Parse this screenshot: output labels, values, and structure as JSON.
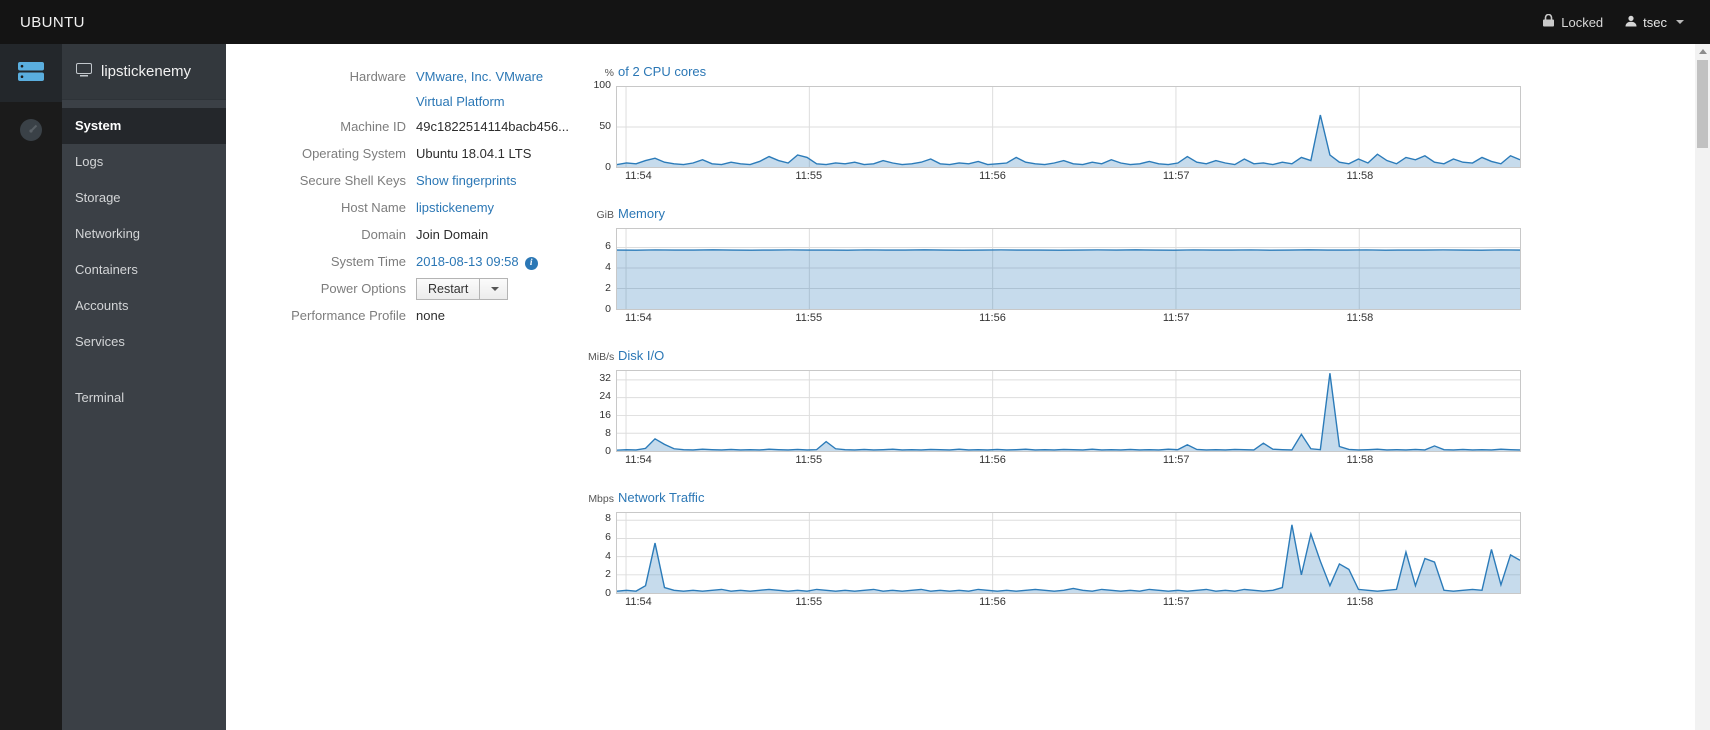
{
  "topbar": {
    "brand": "UBUNTU",
    "locked_label": "Locked",
    "user_label": "tsec"
  },
  "app_strip": {
    "items": [
      {
        "name": "host",
        "icon": "server-icon",
        "active": true
      },
      {
        "name": "dashboard",
        "icon": "gauge-icon",
        "active": false
      }
    ]
  },
  "sidebar": {
    "hostname": "lipstickenemy",
    "items": [
      {
        "label": "System",
        "active": true
      },
      {
        "label": "Logs",
        "active": false
      },
      {
        "label": "Storage",
        "active": false
      },
      {
        "label": "Networking",
        "active": false
      },
      {
        "label": "Containers",
        "active": false
      },
      {
        "label": "Accounts",
        "active": false
      },
      {
        "label": "Services",
        "active": false
      }
    ],
    "footer_items": [
      {
        "label": "Terminal",
        "active": false
      }
    ]
  },
  "system_info": {
    "rows": [
      {
        "label": "Hardware",
        "value": "VMware, Inc. VMware Virtual Platform",
        "style": "link"
      },
      {
        "label": "Machine ID",
        "value": "49c1822514114bacb456...",
        "style": "text"
      },
      {
        "label": "Operating System",
        "value": "Ubuntu 18.04.1 LTS",
        "style": "text"
      },
      {
        "label": "Secure Shell Keys",
        "value": "Show fingerprints",
        "style": "link"
      },
      {
        "label": "Host Name",
        "value": "lipstickenemy",
        "style": "link"
      },
      {
        "label": "Domain",
        "value": "Join Domain",
        "style": "action"
      },
      {
        "label": "System Time",
        "value": "2018-08-13 09:58",
        "style": "link",
        "info_icon": true
      },
      {
        "label": "Power Options",
        "value": "Restart",
        "style": "button_dropdown"
      },
      {
        "label": "Performance Profile",
        "value": "none",
        "style": "text"
      }
    ]
  },
  "colors": {
    "link": "#2b77b5",
    "chart_line": "#2b7bb9",
    "chart_fill": "#2b7bb9",
    "chart_fill_opacity": 0.27,
    "grid": "#dddddd",
    "topbar_bg": "#141414",
    "sidebar_bg": "#3b4046"
  },
  "chart_data": [
    {
      "type": "area",
      "title": "of 2 CPU cores",
      "unit": "%",
      "ylim": [
        0,
        100
      ],
      "yticks": [
        0,
        50,
        100
      ],
      "xticks": [
        "11:54",
        "11:55",
        "11:56",
        "11:57",
        "11:58"
      ],
      "xtick_fracs": [
        0.01,
        0.213,
        0.416,
        0.619,
        0.822
      ],
      "values": [
        3,
        5,
        4,
        8,
        11,
        6,
        4,
        3,
        5,
        9,
        4,
        3,
        6,
        4,
        3,
        7,
        13,
        8,
        5,
        15,
        12,
        4,
        3,
        5,
        4,
        6,
        3,
        4,
        8,
        5,
        3,
        4,
        6,
        10,
        4,
        3,
        5,
        4,
        7,
        3,
        4,
        5,
        12,
        6,
        4,
        3,
        5,
        8,
        4,
        3,
        6,
        4,
        9,
        5,
        3,
        4,
        7,
        4,
        3,
        5,
        13,
        6,
        4,
        8,
        5,
        3,
        10,
        4,
        5,
        3,
        6,
        4,
        12,
        8,
        65,
        15,
        6,
        4,
        10,
        5,
        16,
        8,
        4,
        12,
        9,
        14,
        6,
        4,
        10,
        6,
        5,
        12,
        7,
        4,
        14,
        9
      ]
    },
    {
      "type": "area",
      "title": "Memory",
      "unit": "GiB",
      "ylim": [
        0,
        7.8
      ],
      "yticks": [
        0,
        2,
        4,
        6
      ],
      "xticks": [
        "11:54",
        "11:55",
        "11:56",
        "11:57",
        "11:58"
      ],
      "xtick_fracs": [
        0.01,
        0.213,
        0.416,
        0.619,
        0.822
      ],
      "values": [
        5.75,
        5.74,
        5.76,
        5.75,
        5.75,
        5.77,
        5.75,
        5.74,
        5.75,
        5.76,
        5.75,
        5.75,
        5.74,
        5.76,
        5.75,
        5.75,
        5.77,
        5.75,
        5.74,
        5.75,
        5.76,
        5.75,
        5.75,
        5.74,
        5.75,
        5.76,
        5.75,
        5.77,
        5.75,
        5.74,
        5.76,
        5.75,
        5.75,
        5.76,
        5.74,
        5.75,
        5.77,
        5.75,
        5.75,
        5.76,
        5.74,
        5.75,
        5.75,
        5.76,
        5.75,
        5.74,
        5.76,
        5.75
      ]
    },
    {
      "type": "area",
      "title": "Disk I/O",
      "unit": "MiB/s",
      "ylim": [
        0,
        36
      ],
      "yticks": [
        0,
        8,
        16,
        24,
        32
      ],
      "xticks": [
        "11:54",
        "11:55",
        "11:56",
        "11:57",
        "11:58"
      ],
      "xtick_fracs": [
        0.01,
        0.213,
        0.416,
        0.619,
        0.822
      ],
      "values": [
        0.4,
        0.6,
        0.5,
        1.2,
        5.5,
        3.0,
        1.0,
        0.6,
        0.5,
        0.8,
        0.6,
        0.5,
        0.7,
        0.5,
        0.6,
        0.5,
        0.8,
        0.6,
        0.5,
        0.7,
        0.5,
        0.6,
        4.2,
        1.0,
        0.6,
        0.5,
        0.7,
        0.5,
        0.6,
        0.8,
        0.5,
        0.6,
        0.5,
        0.7,
        0.6,
        0.5,
        0.8,
        0.5,
        0.6,
        0.5,
        0.7,
        0.5,
        0.6,
        0.8,
        0.5,
        0.6,
        0.5,
        0.7,
        0.6,
        0.5,
        0.8,
        0.5,
        0.6,
        0.5,
        0.7,
        0.5,
        0.6,
        0.5,
        0.8,
        0.6,
        2.8,
        0.7,
        0.5,
        0.6,
        0.5,
        0.7,
        0.6,
        0.5,
        3.5,
        0.8,
        0.6,
        0.5,
        7.5,
        1.0,
        0.6,
        35.0,
        2.0,
        0.7,
        0.5,
        0.6,
        0.8,
        0.5,
        0.6,
        0.5,
        0.7,
        0.5,
        2.3,
        0.6,
        0.5,
        0.7,
        0.5,
        0.6,
        0.5,
        0.8,
        0.6,
        0.5
      ]
    },
    {
      "type": "area",
      "title": "Network Traffic",
      "unit": "Mbps",
      "ylim": [
        0,
        8.8
      ],
      "yticks": [
        0,
        2,
        4,
        6,
        8
      ],
      "xticks": [
        "11:54",
        "11:55",
        "11:56",
        "11:57",
        "11:58"
      ],
      "xtick_fracs": [
        0.01,
        0.213,
        0.416,
        0.619,
        0.822
      ],
      "values": [
        0.2,
        0.3,
        0.2,
        0.8,
        5.5,
        0.6,
        0.3,
        0.2,
        0.3,
        0.2,
        0.3,
        0.4,
        0.2,
        0.3,
        0.2,
        0.3,
        0.4,
        0.3,
        0.2,
        0.3,
        0.2,
        0.4,
        0.3,
        0.2,
        0.3,
        0.2,
        0.3,
        0.4,
        0.2,
        0.3,
        0.2,
        0.3,
        0.4,
        0.2,
        0.3,
        0.2,
        0.3,
        0.2,
        0.4,
        0.3,
        0.2,
        0.3,
        0.2,
        0.3,
        0.4,
        0.3,
        0.2,
        0.3,
        0.5,
        0.3,
        0.2,
        0.4,
        0.3,
        0.2,
        0.3,
        0.2,
        0.4,
        0.3,
        0.2,
        0.3,
        0.2,
        0.3,
        0.4,
        0.2,
        0.3,
        0.2,
        0.4,
        0.3,
        0.2,
        0.3,
        0.6,
        7.5,
        2.0,
        6.5,
        3.5,
        0.8,
        3.2,
        2.6,
        0.4,
        0.3,
        0.2,
        0.3,
        0.4,
        4.5,
        0.8,
        3.8,
        3.4,
        0.3,
        0.2,
        0.3,
        0.4,
        0.3,
        4.8,
        0.9,
        4.2,
        3.6
      ]
    }
  ]
}
